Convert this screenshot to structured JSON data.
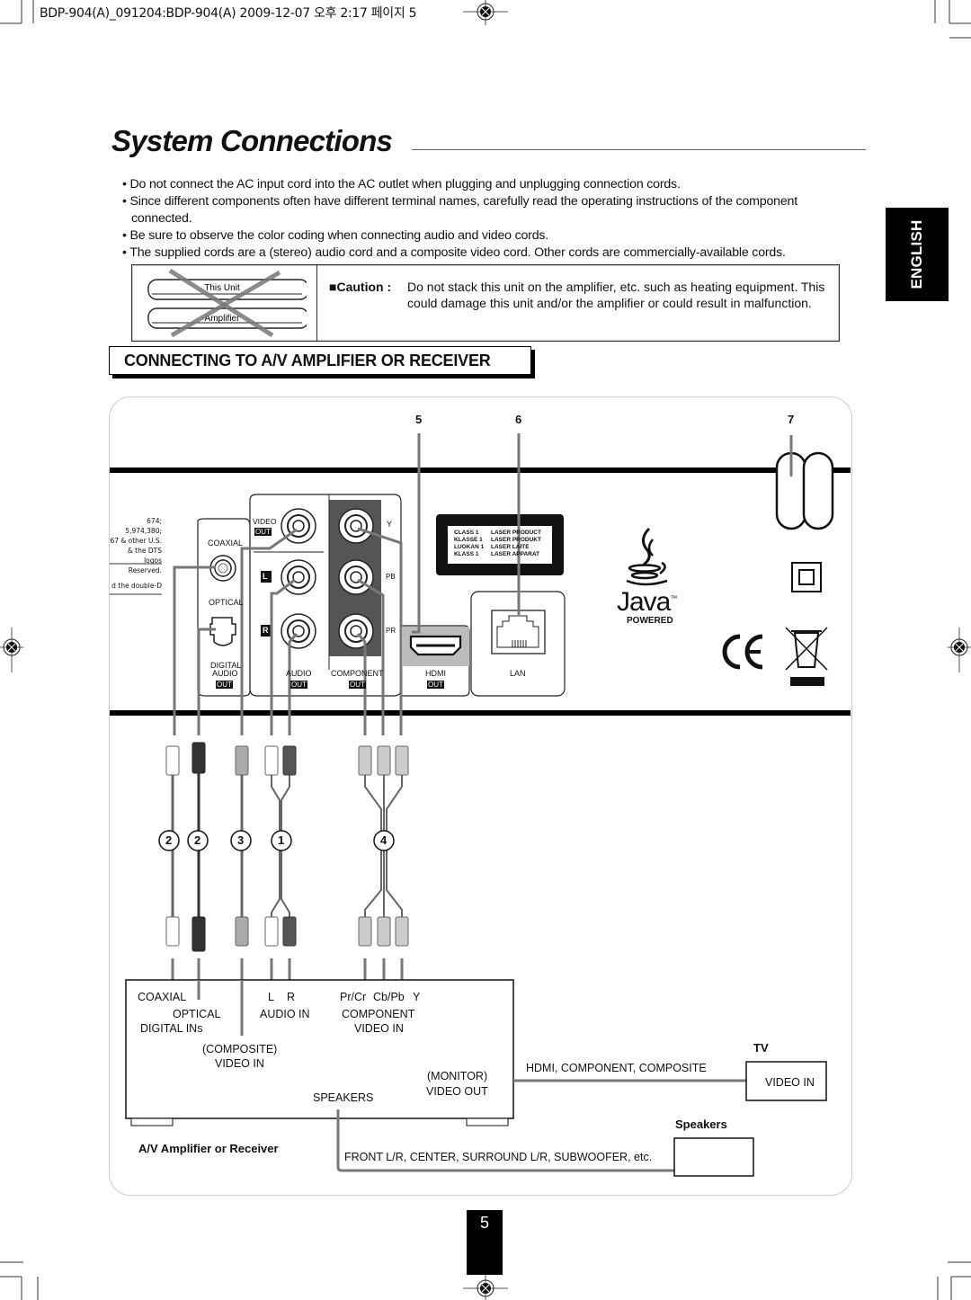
{
  "header": {
    "print_info": "BDP-904(A)_091204:BDP-904(A)  2009-12-07  오후 2:17  페이지 5"
  },
  "page": {
    "title": "System Connections",
    "language_tab": "ENGLISH",
    "page_number": "5"
  },
  "bullets": [
    "• Do not connect the AC input cord into the AC outlet when plugging and unplugging connection cords.",
    "• Since different components often have different terminal names, carefully read the operating instructions of the component connected.",
    "• Be sure to observe the color coding when connecting audio and video cords.",
    "• The supplied cords are a (stereo) audio cord and a composite video cord. Other cords are commercially-available cords."
  ],
  "caution": {
    "illustration": {
      "top_label": "This Unit",
      "bottom_label": "Amplifier"
    },
    "label": "■Caution :",
    "text": "Do not stack this unit on the amplifier, etc. such as heating equipment. This could damage this unit and/or the amplifier or could result in malfunction."
  },
  "section": {
    "heading": "CONNECTING TO A/V AMPLIFIER OR RECEIVER"
  },
  "rear_panel": {
    "callouts": [
      "5",
      "6",
      "7"
    ],
    "patent_text": [
      "674;  5,974,380;",
      "67 & other U.S.",
      "& the DTS logos",
      "Reserved.",
      "d the double-D"
    ],
    "digital_audio": {
      "coaxial": "COAXIAL",
      "optical": "OPTICAL",
      "label_line1": "DIGITAL",
      "label_line2": "AUDIO",
      "out": "OUT"
    },
    "video_out": {
      "label": "VIDEO",
      "out": "OUT"
    },
    "audio_out": {
      "l": "L",
      "r": "R",
      "label": "AUDIO",
      "out": "OUT"
    },
    "component_out": {
      "y": "Y",
      "pb": "PB",
      "pr": "PR",
      "label": "COMPONENT",
      "out": "OUT"
    },
    "hdmi": {
      "label": "HDMI",
      "out": "OUT"
    },
    "lan": {
      "label": "LAN"
    },
    "laser_label": [
      [
        "CLASS 1",
        "LASER PRODUCT"
      ],
      [
        "KLASSE 1",
        "LASER PRODUKT"
      ],
      [
        "LUOKAN 1",
        "LASER LAITE"
      ],
      [
        "KLASS 1",
        "LASER APPARAT"
      ]
    ],
    "java": {
      "word": "Java",
      "tm": "™",
      "powered": "POWERED"
    },
    "ce_mark": "CE"
  },
  "cables": {
    "numbers": [
      "2",
      "2",
      "3",
      "1",
      "4"
    ]
  },
  "amplifier": {
    "coaxial": "COAXIAL",
    "optical": "OPTICAL",
    "digital_ins": "DIGITAL INs",
    "audio_l": "L",
    "audio_r": "R",
    "audio_in": "AUDIO IN",
    "pr_cr": "Pr/Cr",
    "cb_pb": "Cb/Pb",
    "y": "Y",
    "component": "COMPONENT",
    "component_video_in": "VIDEO IN",
    "composite": "(COMPOSITE)",
    "composite_video_in": "VIDEO IN",
    "monitor": "(MONITOR)",
    "video_out": "VIDEO OUT",
    "speakers": "SPEAKERS",
    "caption": "A/V Amplifier or Receiver"
  },
  "tv": {
    "title": "TV",
    "connection_label": "HDMI, COMPONENT, COMPOSITE",
    "video_in": "VIDEO IN"
  },
  "speakers": {
    "title": "Speakers",
    "connection_label": "FRONT L/R, CENTER, SURROUND L/R, SUBWOOFER, etc."
  }
}
